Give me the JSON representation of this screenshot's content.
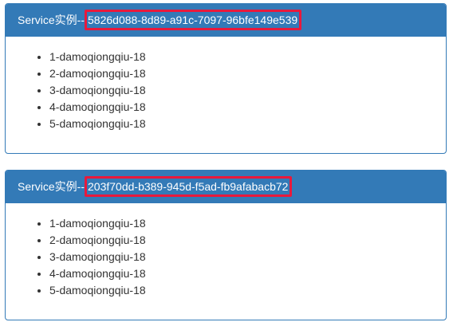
{
  "panels": [
    {
      "prefix": "Service实例--",
      "instance_id": "5826d088-8d89-a91c-7097-96bfe149e539",
      "items": [
        "1-damoqiongqiu-18",
        "2-damoqiongqiu-18",
        "3-damoqiongqiu-18",
        "4-damoqiongqiu-18",
        "5-damoqiongqiu-18"
      ]
    },
    {
      "prefix": "Service实例--",
      "instance_id": "203f70dd-b389-945d-f5ad-fb9afabacb72",
      "items": [
        "1-damoqiongqiu-18",
        "2-damoqiongqiu-18",
        "3-damoqiongqiu-18",
        "4-damoqiongqiu-18",
        "5-damoqiongqiu-18"
      ]
    }
  ],
  "colors": {
    "panel_primary": "#337ab7",
    "highlight_border": "#e8193c",
    "text": "#333333"
  }
}
